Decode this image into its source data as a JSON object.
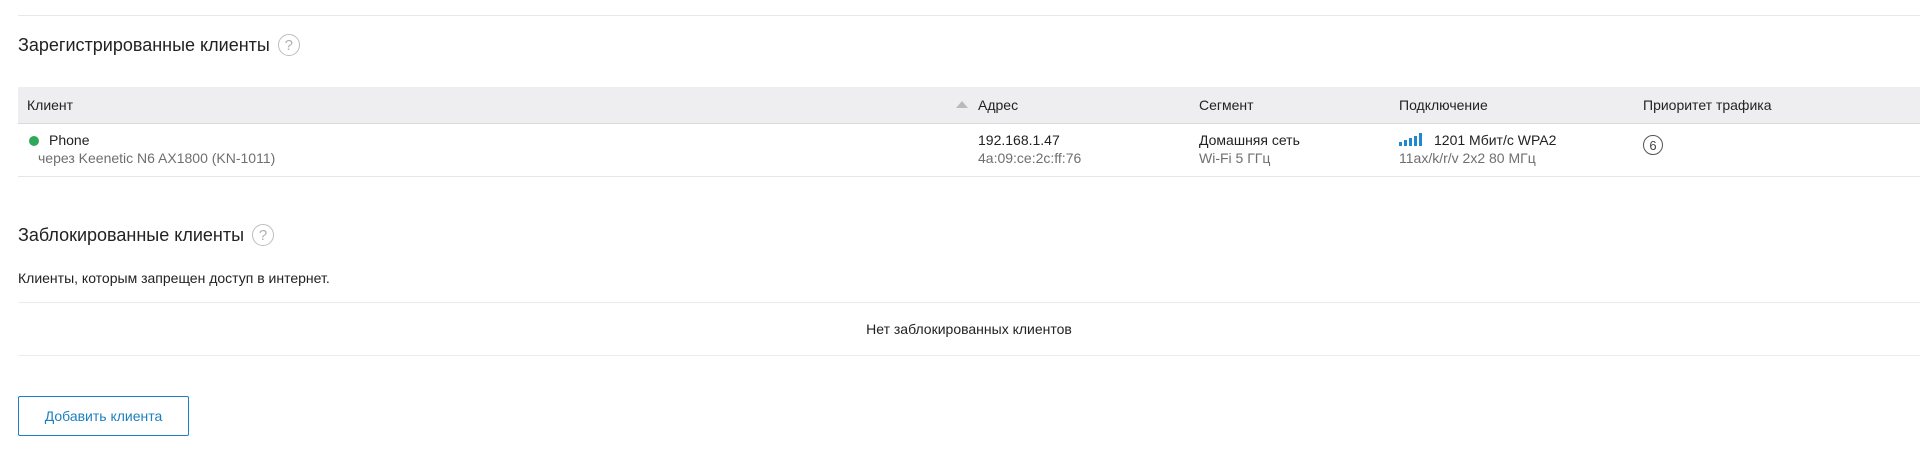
{
  "registered": {
    "title": "Зарегистрированные клиенты",
    "help_icon": "?"
  },
  "table": {
    "columns": [
      "Клиент",
      "Адрес",
      "Сегмент",
      "Подключение",
      "Приоритет трафика"
    ],
    "rows": [
      {
        "status": "online",
        "status_color": "#2fa85a",
        "name": "Phone",
        "via": "через Keenetic N6 AX1800 (KN-1011)",
        "ip": "192.168.1.47",
        "mac": "4a:09:ce:2c:ff:76",
        "segment": "Домашняя сеть",
        "band": "Wi-Fi 5 ГГц",
        "signal_icon": "signal-bars-icon",
        "speed": "1201 Мбит/с WPA2",
        "mode": "11ax/k/r/v 2x2 80 МГц",
        "priority": "6"
      }
    ]
  },
  "blocked": {
    "title": "Заблокированные клиенты",
    "help_icon": "?",
    "description": "Клиенты, которым запрещен доступ в интернет.",
    "empty_text": "Нет заблокированных клиентов"
  },
  "actions": {
    "add_client_label": "Добавить клиента"
  },
  "colors": {
    "accent": "#1c7fbe",
    "signal": "#1e88d2",
    "online": "#2fa85a"
  }
}
